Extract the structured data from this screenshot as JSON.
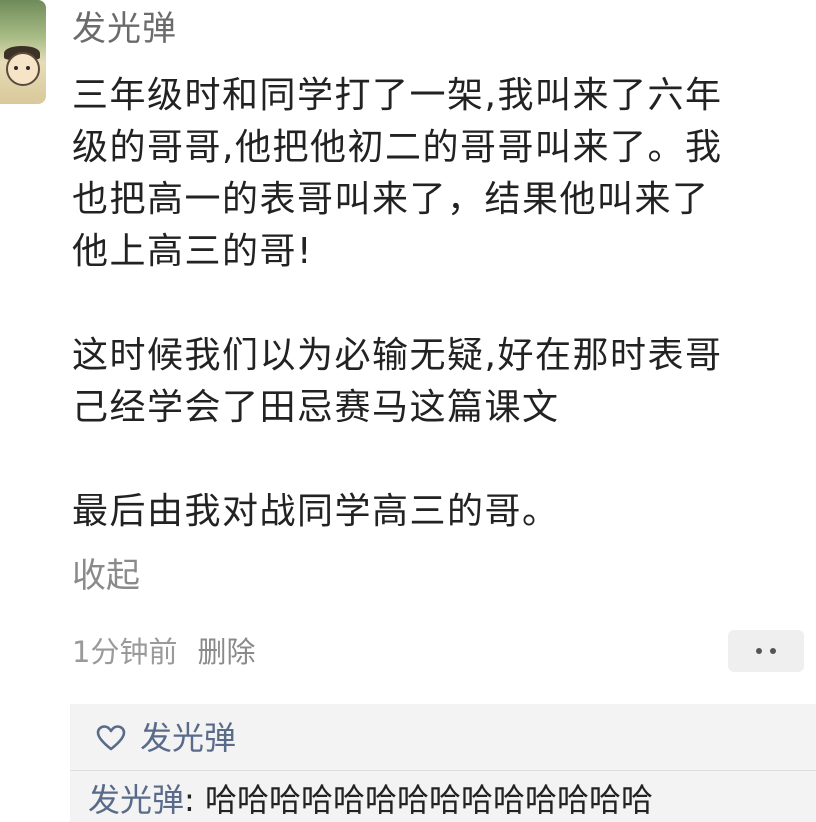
{
  "post": {
    "author": "发光弹",
    "paragraphs": [
      "三年级时和同学打了一架,我叫来了六年\n级的哥哥,他把他初二的哥哥叫来了。我\n也把高一的表哥叫来了，结果他叫来了\n他上高三的哥!",
      "这时候我们以为必输无疑,好在那时表哥\n己经学会了田忌赛马这篇课文",
      "最后由我对战同学高三的哥。"
    ],
    "collapse_label": "收起",
    "timestamp": "1分钟前",
    "delete_label": "删除"
  },
  "likes": {
    "icon": "heart-icon",
    "user": "发光弹"
  },
  "reply": {
    "author": "发光弹",
    "separator": ": ",
    "text": "哈哈哈哈哈哈哈哈哈哈哈哈哈哈"
  },
  "colors": {
    "link": "#5a6b8a",
    "text": "#222222",
    "muted": "#9a9a9a",
    "panel": "#f3f3f3"
  }
}
